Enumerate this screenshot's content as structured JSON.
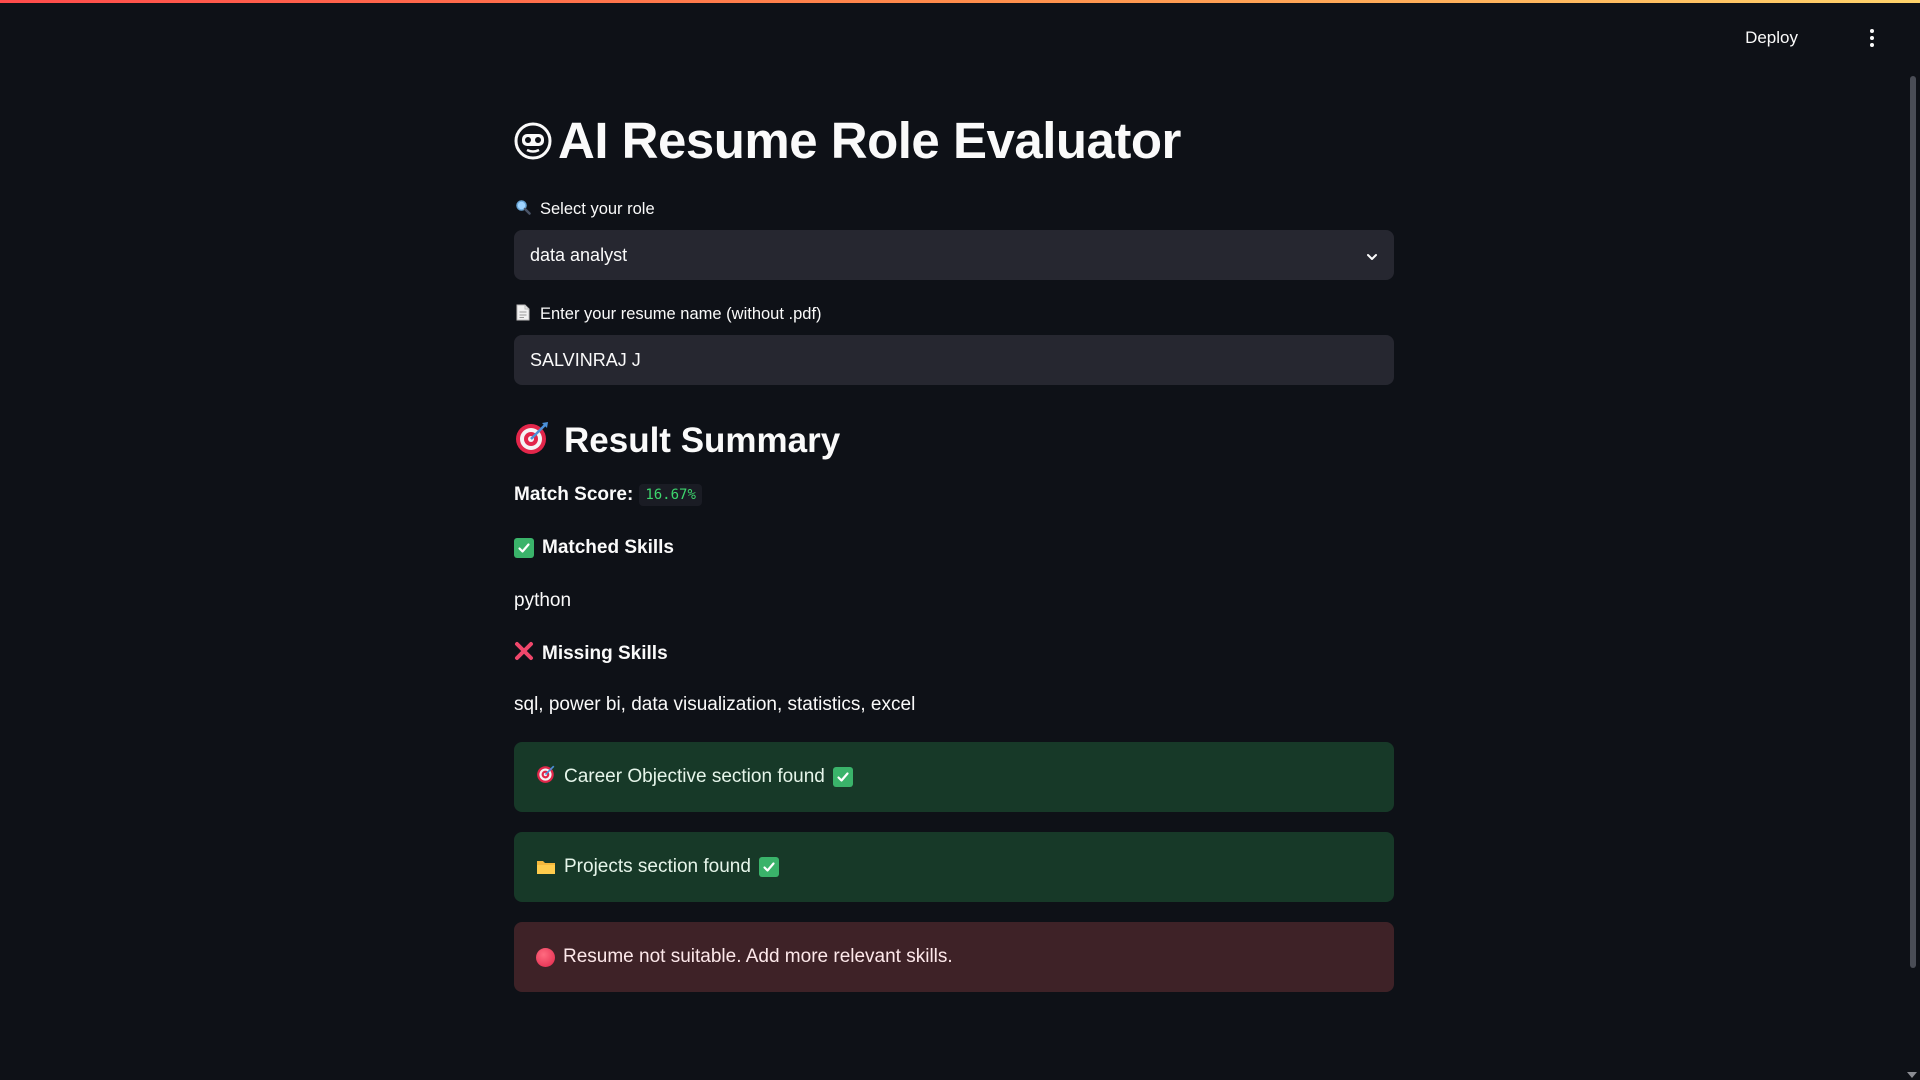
{
  "header": {
    "deploy_label": "Deploy",
    "menu_icon": "more-vertical-icon"
  },
  "app": {
    "title": "AI Resume Role Evaluator",
    "title_icon": "robot-face-icon"
  },
  "role_select": {
    "label": "Select your role",
    "label_icon": "magnifier-icon",
    "selected_value": "data analyst"
  },
  "resume_input": {
    "label": "Enter your resume name (without .pdf)",
    "label_icon": "page-icon",
    "value": "SALVINRAJ J"
  },
  "result": {
    "heading": "Result Summary",
    "heading_icon": "target-icon",
    "match_score_label": "Match Score:",
    "match_score_value": "16.67%",
    "matched_heading": "Matched Skills",
    "matched_skills": "python",
    "missing_heading": "Missing Skills",
    "missing_skills": "sql, power bi, data visualization, statistics, excel"
  },
  "alerts": {
    "career": "Career Objective section found",
    "projects": "Projects section found",
    "verdict": "Resume not suitable. Add more relevant skills."
  },
  "colors": {
    "background": "#0e1117",
    "input_bg": "#262730",
    "success_bg": "#173928",
    "error_bg": "#3e2227",
    "code_green": "#3dd56d"
  }
}
